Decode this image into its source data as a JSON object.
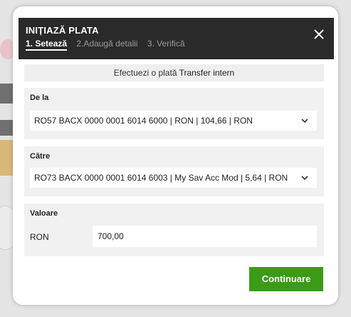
{
  "modal": {
    "title": "INIȚIAZĂ PLATA",
    "steps": [
      {
        "label": "1. Setează",
        "active": true
      },
      {
        "label": "2.Adaugă detalii",
        "active": false
      },
      {
        "label": "3. Verifică",
        "active": false
      }
    ],
    "close_icon": "close-icon"
  },
  "banner": {
    "prefix": "Efectuezi o plată",
    "type": "Transfer intern"
  },
  "from": {
    "label": "De la",
    "value": "RO57 BACX 0000 0001 6014 6000 | RON | 104,66 | RON"
  },
  "to": {
    "label": "Către",
    "value": "RO73 BACX 0000 0001 6014 6003 | My Sav Acc Mod | 5,64 | RON"
  },
  "amount": {
    "label": "Valoare",
    "currency": "RON",
    "value": "700,00"
  },
  "actions": {
    "continue_label": "Continuare"
  },
  "colors": {
    "header_bg": "#2a2a2a",
    "button_bg": "#3c9b16"
  }
}
